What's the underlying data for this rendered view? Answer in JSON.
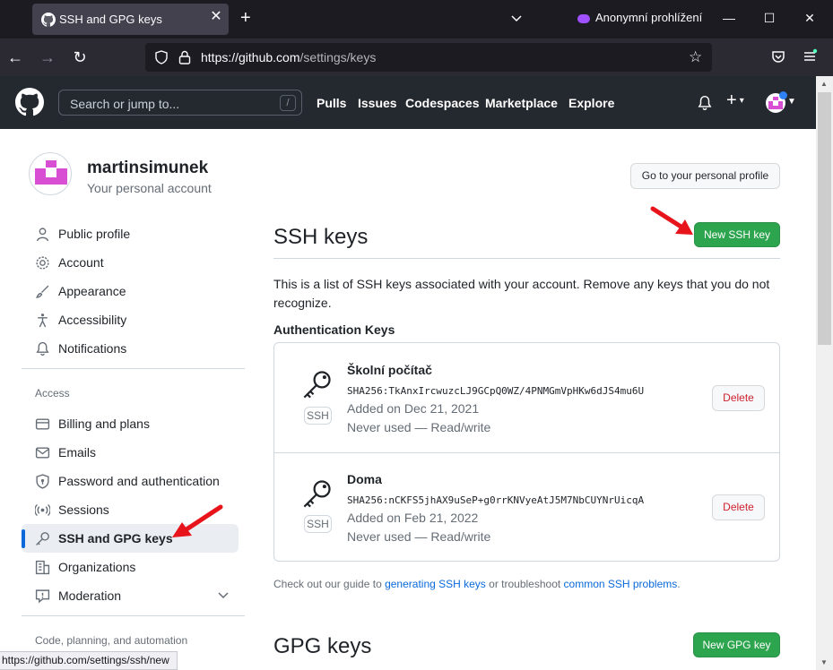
{
  "browser": {
    "tab_title": "SSH and GPG keys",
    "private_label": "Anonymní prohlížení",
    "url_host": "https://github.com",
    "url_path": "/settings/keys",
    "status_url": "https://github.com/settings/ssh/new",
    "colors": {
      "tabbar": "#1c1b22",
      "navbar": "#2b2a33",
      "private_accent": "#a050ff"
    }
  },
  "github_header": {
    "search_placeholder": "Search or jump to...",
    "search_shortcut": "/",
    "nav": [
      "Pulls",
      "Issues",
      "Codespaces",
      "Marketplace",
      "Explore"
    ],
    "colors": {
      "background": "#24292f"
    }
  },
  "profile": {
    "username": "martinsimunek",
    "subtitle": "Your personal account",
    "profile_button": "Go to your personal profile"
  },
  "sidebar": {
    "items_top": [
      {
        "label": "Public profile",
        "icon": "person-icon"
      },
      {
        "label": "Account",
        "icon": "gear-icon"
      },
      {
        "label": "Appearance",
        "icon": "paintbrush-icon"
      },
      {
        "label": "Accessibility",
        "icon": "accessibility-icon"
      },
      {
        "label": "Notifications",
        "icon": "bell-icon"
      }
    ],
    "access_heading": "Access",
    "items_access": [
      {
        "label": "Billing and plans",
        "icon": "credit-card-icon"
      },
      {
        "label": "Emails",
        "icon": "mail-icon"
      },
      {
        "label": "Password and authentication",
        "icon": "shield-lock-icon"
      },
      {
        "label": "Sessions",
        "icon": "broadcast-icon"
      },
      {
        "label": "SSH and GPG keys",
        "icon": "key-icon",
        "active": true
      },
      {
        "label": "Organizations",
        "icon": "organization-icon"
      },
      {
        "label": "Moderation",
        "icon": "report-icon"
      }
    ],
    "code_heading": "Code, planning, and automation"
  },
  "main": {
    "ssh_title": "SSH keys",
    "new_ssh_button": "New SSH key",
    "description": "This is a list of SSH keys associated with your account. Remove any keys that you do not recognize.",
    "auth_heading": "Authentication Keys",
    "keys": [
      {
        "name": "Školní počítač",
        "fingerprint": "SHA256:TkAnxIrcwuzcLJ9GCpQ0WZ/4PNMGmVpHKw6dJS4mu6U",
        "added": "Added on Dec 21, 2021",
        "usage": "Never used — Read/write",
        "badge": "SSH",
        "delete_label": "Delete"
      },
      {
        "name": "Doma",
        "fingerprint": "SHA256:nCKFS5jhAX9uSeP+g0rrKNVyeAtJ5M7NbCUYNrUicqA",
        "added": "Added on Feb 21, 2022",
        "usage": "Never used — Read/write",
        "badge": "SSH",
        "delete_label": "Delete"
      }
    ],
    "guide_prefix": "Check out our guide to ",
    "guide_link1": "generating SSH keys",
    "guide_middle": " or troubleshoot ",
    "guide_link2": "common SSH problems",
    "guide_suffix": ".",
    "gpg_title": "GPG keys",
    "new_gpg_button": "New GPG key",
    "colors": {
      "green_button": "#2da44e",
      "link": "#0969da",
      "danger": "#cf222e",
      "annotation_arrow": "#e8141c"
    }
  }
}
